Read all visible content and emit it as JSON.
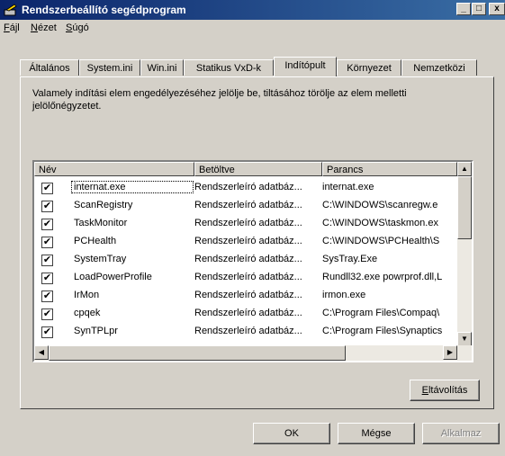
{
  "window": {
    "title": "Rendszerbeállító segédprogram",
    "controls": {
      "minimize": "_",
      "maximize": "□",
      "close": "x"
    }
  },
  "menu": [
    "Fájl",
    "Nézet",
    "Súgó"
  ],
  "tabs": [
    {
      "label": "Általános",
      "active": false
    },
    {
      "label": "System.ini",
      "active": false
    },
    {
      "label": "Win.ini",
      "active": false
    },
    {
      "label": "Statikus VxD-k",
      "active": false
    },
    {
      "label": "Indítópult",
      "active": true
    },
    {
      "label": "Környezet",
      "active": false
    },
    {
      "label": "Nemzetközi",
      "active": false
    }
  ],
  "description": "Valamely indítási elem engedélyezéséhez jelölje be, tiltásához törölje az elem melletti jelölőnégyzetet.",
  "list": {
    "columns": [
      "Név",
      "Betöltve",
      "Parancs"
    ],
    "rows": [
      {
        "checked": true,
        "name": "internat.exe",
        "source": "Rendszerleíró adatbáz...",
        "command": "internat.exe"
      },
      {
        "checked": true,
        "name": "ScanRegistry",
        "source": "Rendszerleíró adatbáz...",
        "command": "C:\\WINDOWS\\scanregw.e"
      },
      {
        "checked": true,
        "name": "TaskMonitor",
        "source": "Rendszerleíró adatbáz...",
        "command": "C:\\WINDOWS\\taskmon.ex"
      },
      {
        "checked": true,
        "name": "PCHealth",
        "source": "Rendszerleíró adatbáz...",
        "command": "C:\\WINDOWS\\PCHealth\\S"
      },
      {
        "checked": true,
        "name": "SystemTray",
        "source": "Rendszerleíró adatbáz...",
        "command": "SysTray.Exe"
      },
      {
        "checked": true,
        "name": "LoadPowerProfile",
        "source": "Rendszerleíró adatbáz...",
        "command": "Rundll32.exe powrprof.dll,L"
      },
      {
        "checked": true,
        "name": "IrMon",
        "source": "Rendszerleíró adatbáz...",
        "command": "irmon.exe"
      },
      {
        "checked": true,
        "name": "cpqek",
        "source": "Rendszerleíró adatbáz...",
        "command": "C:\\Program Files\\Compaq\\"
      },
      {
        "checked": true,
        "name": "SynTPLpr",
        "source": "Rendszerleíró adatbáz...",
        "command": "C:\\Program Files\\Synaptics"
      }
    ]
  },
  "buttons": {
    "remove": "Eltávolítás",
    "ok": "OK",
    "cancel": "Mégse",
    "apply": "Alkalmaz"
  }
}
